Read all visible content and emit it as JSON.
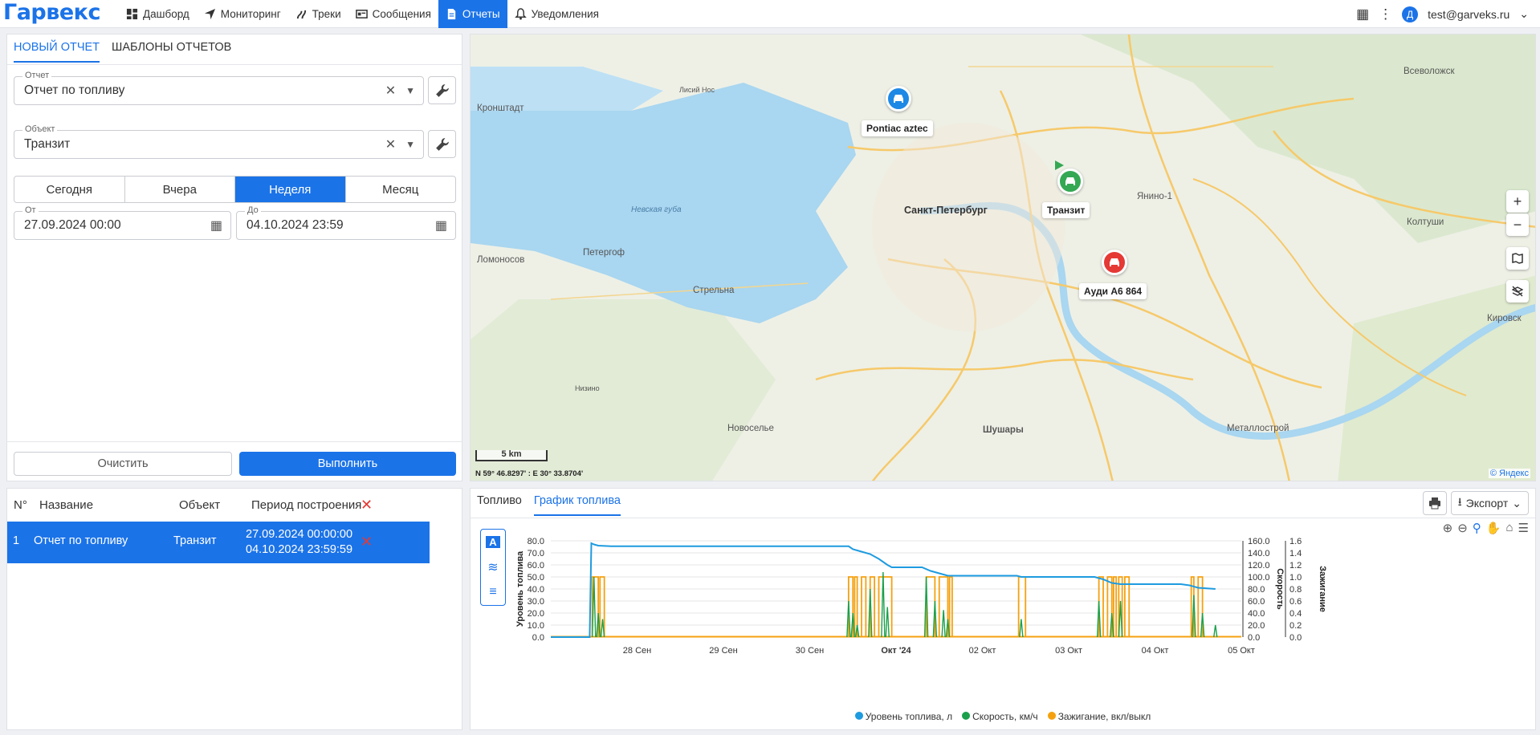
{
  "app": {
    "logo": "Гарвекс",
    "user_initial": "Д",
    "user_email": "test@garveks.ru"
  },
  "nav": [
    {
      "label": "Дашборд",
      "icon": "dashboard-icon"
    },
    {
      "label": "Мониторинг",
      "icon": "navigation-icon"
    },
    {
      "label": "Треки",
      "icon": "tracks-icon"
    },
    {
      "label": "Сообщения",
      "icon": "messages-icon"
    },
    {
      "label": "Отчеты",
      "icon": "report-icon",
      "active": true
    },
    {
      "label": "Уведомления",
      "icon": "bell-icon"
    }
  ],
  "left_panel": {
    "tabs": [
      "НОВЫЙ ОТЧЕТ",
      "ШАБЛОНЫ ОТЧЕТОВ"
    ],
    "report_field": {
      "label": "Отчет",
      "value": "Отчет по топливу"
    },
    "object_field": {
      "label": "Объект",
      "value": "Транзит"
    },
    "periods": [
      "Сегодня",
      "Вчера",
      "Неделя",
      "Месяц"
    ],
    "active_period": "Неделя",
    "from_field": {
      "label": "От",
      "value": "27.09.2024 00:00"
    },
    "to_field": {
      "label": "До",
      "value": "04.10.2024 23:59"
    },
    "clear_label": "Очистить",
    "run_label": "Выполнить"
  },
  "reports_table": {
    "headers": [
      "N°",
      "Название",
      "Объект",
      "Период построения"
    ],
    "rows": [
      {
        "num": "1",
        "name": "Отчет по топливу",
        "object": "Транзит",
        "period_from": "27.09.2024 00:00:00",
        "period_to": "04.10.2024 23:59:59"
      }
    ]
  },
  "map": {
    "labels": [
      "Кронштадт",
      "Ломоносов",
      "Петергоф",
      "Стрельна",
      "Санкт-Петербург",
      "Невская губа",
      "Новоселье",
      "Шушары",
      "Металлострой",
      "Колтуши",
      "Всеволожск",
      "Янино-1",
      "Кировск",
      "Лисий Нос",
      "Низино"
    ],
    "vehicles": [
      {
        "name": "Pontiac aztec",
        "color": "#1e88e5"
      },
      {
        "name": "Транзит",
        "color": "#34a853"
      },
      {
        "name": "Ауди А6 864",
        "color": "#e53935"
      }
    ],
    "scale": "5 km",
    "coords": "N 59° 46.8297' : E 30° 33.8704'",
    "copyright": "© Яндекс"
  },
  "chart_panel": {
    "tabs": [
      "Топливо",
      "График топлива"
    ],
    "active_tab": "График топлива",
    "export_label": "Экспорт"
  },
  "chart_data": {
    "type": "line",
    "x_ticks": [
      "28 Сен",
      "29 Сен",
      "30 Сен",
      "Окт '24",
      "02 Окт",
      "03 Окт",
      "04 Окт",
      "05 Окт"
    ],
    "y_left": {
      "label": "Уровень топлива",
      "ticks": [
        "80.0",
        "70.0",
        "60.0",
        "50.0",
        "40.0",
        "30.0",
        "20.0",
        "10.0",
        "0.0"
      ],
      "range": [
        0,
        80
      ]
    },
    "y_right1": {
      "label": "Скорость",
      "ticks": [
        "160.0",
        "140.0",
        "120.0",
        "100.0",
        "80.0",
        "60.0",
        "40.0",
        "20.0",
        "0.0"
      ],
      "range": [
        0,
        160
      ]
    },
    "y_right2": {
      "label": "Зажигание",
      "ticks": [
        "1.6",
        "1.4",
        "1.2",
        "1.0",
        "0.8",
        "0.6",
        "0.4",
        "0.2",
        "0.0"
      ],
      "range": [
        0,
        1.6
      ]
    },
    "x_range": [
      27,
      35
    ],
    "series": [
      {
        "name": "Уровень топлива, л",
        "color": "#1e9be0",
        "points": [
          [
            27.0,
            0
          ],
          [
            27.45,
            0
          ],
          [
            27.47,
            78
          ],
          [
            27.5,
            77
          ],
          [
            27.55,
            76
          ],
          [
            27.7,
            75.5
          ],
          [
            29.5,
            75.5
          ],
          [
            30.45,
            75.5
          ],
          [
            30.5,
            73
          ],
          [
            30.6,
            71
          ],
          [
            30.7,
            69
          ],
          [
            30.8,
            65
          ],
          [
            30.9,
            60
          ],
          [
            30.95,
            58
          ],
          [
            31.3,
            58
          ],
          [
            31.4,
            55
          ],
          [
            31.5,
            53
          ],
          [
            31.6,
            51
          ],
          [
            31.8,
            51
          ],
          [
            32.0,
            51
          ],
          [
            32.4,
            51
          ],
          [
            32.45,
            50
          ],
          [
            33.3,
            50
          ],
          [
            33.4,
            48
          ],
          [
            33.5,
            45
          ],
          [
            33.6,
            44
          ],
          [
            34.3,
            44
          ],
          [
            34.4,
            43
          ],
          [
            34.5,
            41
          ],
          [
            34.7,
            40
          ]
        ]
      },
      {
        "name": "Скорость, км/ч",
        "color": "#1aa04a",
        "spikes": [
          [
            27.5,
            100
          ],
          [
            27.55,
            40
          ],
          [
            27.6,
            30
          ],
          [
            30.45,
            60
          ],
          [
            30.5,
            40
          ],
          [
            30.55,
            20
          ],
          [
            30.7,
            80
          ],
          [
            30.85,
            108
          ],
          [
            30.9,
            50
          ],
          [
            31.35,
            100
          ],
          [
            31.45,
            60
          ],
          [
            31.55,
            45
          ],
          [
            31.6,
            30
          ],
          [
            32.45,
            30
          ],
          [
            33.35,
            60
          ],
          [
            33.5,
            40
          ],
          [
            33.6,
            60
          ],
          [
            34.45,
            70
          ],
          [
            34.55,
            40
          ],
          [
            34.7,
            20
          ]
        ]
      },
      {
        "name": "Зажигание, вкл/выкл",
        "color": "#f5a10f",
        "pulses": [
          [
            27.48,
            27.55
          ],
          [
            27.57,
            27.62
          ],
          [
            30.45,
            30.5
          ],
          [
            30.52,
            30.55
          ],
          [
            30.6,
            30.65
          ],
          [
            30.7,
            30.75
          ],
          [
            30.8,
            30.95
          ],
          [
            31.35,
            31.45
          ],
          [
            31.5,
            31.6
          ],
          [
            31.62,
            31.65
          ],
          [
            32.42,
            32.5
          ],
          [
            33.35,
            33.4
          ],
          [
            33.45,
            33.5
          ],
          [
            33.52,
            33.55
          ],
          [
            33.58,
            33.62
          ],
          [
            33.65,
            33.7
          ],
          [
            34.42,
            34.45
          ],
          [
            34.5,
            34.55
          ]
        ]
      }
    ]
  }
}
